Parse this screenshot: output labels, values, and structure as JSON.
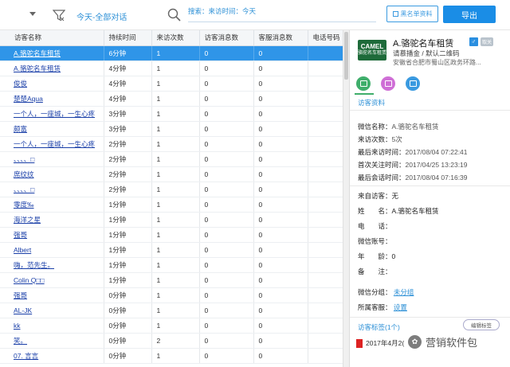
{
  "toolbar": {
    "filter_text": "今天-全部对话",
    "search_text": "搜索：来访时间：今天",
    "blacklist_label": "黑名单资料",
    "export_label": "导出"
  },
  "table": {
    "columns": [
      "访客名称",
      "持续时间",
      "来访次数",
      "访客消息数",
      "客服消息数",
      "电话号码"
    ],
    "rows": [
      [
        "A.骆驼名车租赁",
        "6分钟",
        "1",
        "0",
        "0"
      ],
      [
        "A.骆驼名车租赁",
        "4分钟",
        "1",
        "0",
        "0"
      ],
      [
        "俊俊",
        "4分钟",
        "1",
        "0",
        "0"
      ],
      [
        "楚楚Aqua",
        "4分钟",
        "1",
        "0",
        "0"
      ],
      [
        "一个人，一座城，一生心疼",
        "3分钟",
        "1",
        "0",
        "0"
      ],
      [
        "颇富",
        "3分钟",
        "1",
        "0",
        "0"
      ],
      [
        "一个人，一座城，一生心疼",
        "2分钟",
        "1",
        "0",
        "0"
      ],
      [
        "、、、、□",
        "2分钟",
        "1",
        "0",
        "0"
      ],
      [
        "席纹纹",
        "2分钟",
        "1",
        "0",
        "0"
      ],
      [
        "、、、、□",
        "2分钟",
        "1",
        "0",
        "0"
      ],
      [
        "零度‰",
        "1分钟",
        "1",
        "0",
        "0"
      ],
      [
        "海洋之星",
        "1分钟",
        "1",
        "0",
        "0"
      ],
      [
        "强哥",
        "1分钟",
        "1",
        "0",
        "0"
      ],
      [
        "Albert",
        "1分钟",
        "1",
        "0",
        "0"
      ],
      [
        "嗨，范先生。",
        "1分钟",
        "1",
        "0",
        "0"
      ],
      [
        "Colin Q□□",
        "1分钟",
        "1",
        "0",
        "0"
      ],
      [
        "强哥",
        "0分钟",
        "1",
        "0",
        "0"
      ],
      [
        "AL-JK",
        "0分钟",
        "1",
        "0",
        "0"
      ],
      [
        "kk",
        "0分钟",
        "1",
        "0",
        "0"
      ],
      [
        "笑。",
        "0分钟",
        "2",
        "0",
        "0"
      ],
      [
        "07. 言言",
        "0分钟",
        "1",
        "0",
        "0"
      ]
    ]
  },
  "panel": {
    "logo_big": "CAMEL",
    "logo_small": "骆驼名车租赁",
    "name": "A.骆驼名车租赁",
    "gender": "♂",
    "badge": "取关",
    "source": "请慕播金 / 默认二维码",
    "address": "安徽省合肥市蜀山区政务环路...",
    "section_title": "访客资料",
    "fields": [
      {
        "label": "微信名称：",
        "value": "A.骆驼名车租赁"
      },
      {
        "label": "来访次数：",
        "value": "5次"
      },
      {
        "label": "最后来访时间：",
        "value": "2017/08/04 07:22:41"
      },
      {
        "label": "首次关注时间：",
        "value": "2017/04/25 13:23:19"
      },
      {
        "label": "最后会话时间：",
        "value": "2017/08/04 07:16:39"
      }
    ],
    "details": [
      {
        "label": "来自访客：",
        "value": "无"
      },
      {
        "label": "姓　　名：",
        "value": "A.骆驼名车租赁"
      },
      {
        "label": "电　　话：",
        "value": ""
      },
      {
        "label": "微信账号：",
        "value": ""
      },
      {
        "label": "年　　龄：",
        "value": "0"
      },
      {
        "label": "备　　注：",
        "value": ""
      }
    ],
    "wechat_group_label": "微信分组：",
    "wechat_group_value": "未分组",
    "agent_label": "所属客服：",
    "agent_value": "设置",
    "tags_title": "访客标签(1个)",
    "edit_tags": "编辑标签",
    "tag_entry": "2017年4月2("
  },
  "watermark": "营销软件包"
}
